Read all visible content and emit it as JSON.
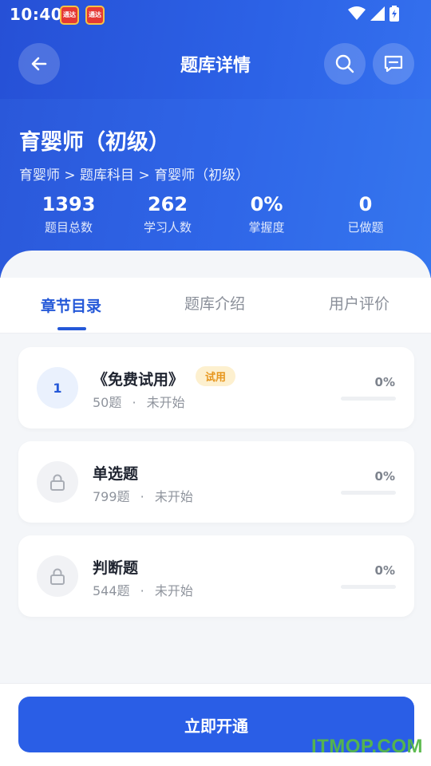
{
  "status_bar": {
    "time": "10:40",
    "badge_text": "通达"
  },
  "nav": {
    "title": "题库详情",
    "back_icon": "arrow-left-icon",
    "search_icon": "search-icon",
    "message_icon": "message-icon"
  },
  "course": {
    "title": "育婴师（初级）",
    "breadcrumb": "育婴师 > 题库科目 > 育婴师（初级）",
    "stats": [
      {
        "value": "1393",
        "label": "题目总数"
      },
      {
        "value": "262",
        "label": "学习人数"
      },
      {
        "value": "0%",
        "label": "掌握度"
      },
      {
        "value": "0",
        "label": "已做题"
      }
    ]
  },
  "tabs": [
    {
      "label": "章节目录",
      "active": true
    },
    {
      "label": "题库介绍",
      "active": false
    },
    {
      "label": "用户评价",
      "active": false
    }
  ],
  "chapters": [
    {
      "index": "1",
      "title": "《免费试用》",
      "badge": "试用",
      "count": "50题",
      "sep": "·",
      "status": "未开始",
      "percent": "0%",
      "progress": 0,
      "locked": false
    },
    {
      "index": "",
      "title": "单选题",
      "badge": "",
      "count": "799题",
      "sep": "·",
      "status": "未开始",
      "percent": "0%",
      "progress": 0,
      "locked": true
    },
    {
      "index": "",
      "title": "判断题",
      "badge": "",
      "count": "544题",
      "sep": "·",
      "status": "未开始",
      "percent": "0%",
      "progress": 0,
      "locked": true
    }
  ],
  "cta": {
    "label": "立即开通"
  },
  "watermark": "ITMOP.COM",
  "colors": {
    "primary": "#2458d8",
    "header_start": "#2650d6",
    "header_end": "#3576ee",
    "trial_badge_bg": "#fdf0cf",
    "trial_badge_fg": "#e7961d"
  }
}
